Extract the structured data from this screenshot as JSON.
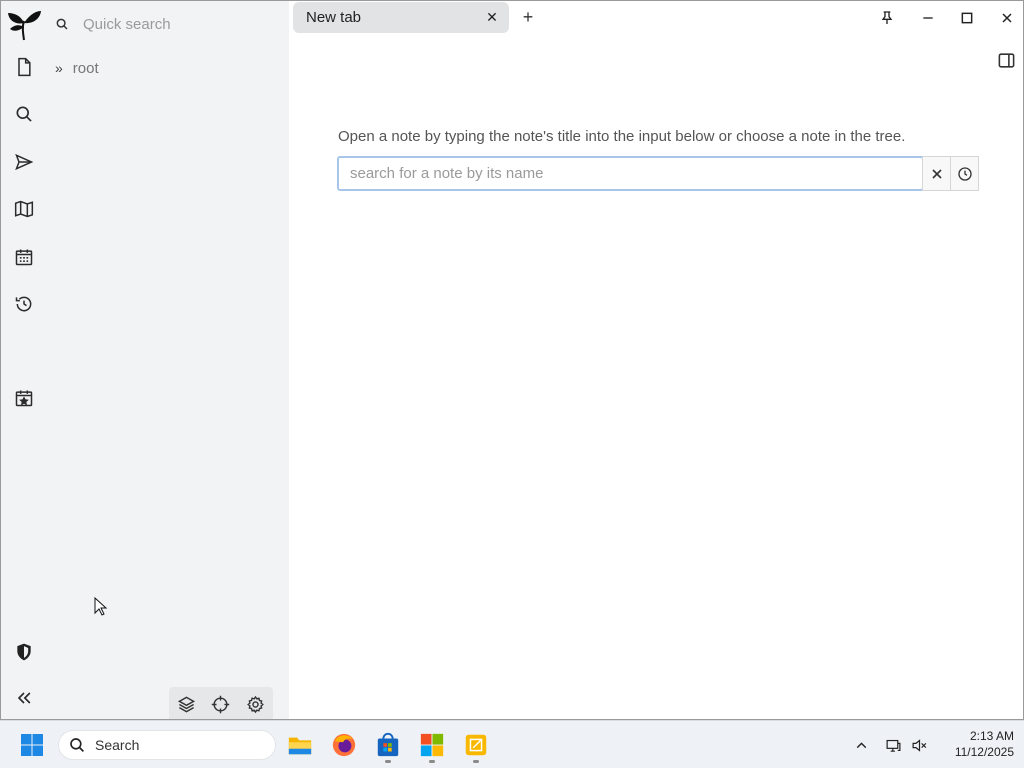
{
  "app": {
    "quick_search_placeholder": "Quick search",
    "tree": {
      "root_label": "root"
    },
    "tabs": [
      {
        "title": "New tab"
      }
    ],
    "main": {
      "help_text": "Open a note by typing the note's title into the input below or choose a note in the tree.",
      "search_placeholder": "search for a note by its name"
    },
    "accent_color": "#a8c5ea",
    "launcher_icons": [
      "new-note-icon",
      "search-icon",
      "send-icon",
      "map-icon",
      "calendar-icon",
      "history-icon",
      "calendar-star-icon",
      "shield-icon",
      "collapse-sidebar-icon"
    ],
    "bottom_tool_icons": [
      "layers-icon",
      "crosshair-icon",
      "gear-icon"
    ]
  },
  "taskbar": {
    "search_label": "Search",
    "apps": [
      "file-explorer-icon",
      "firefox-icon",
      "store-icon",
      "microsoft-icon",
      "notes-app-icon"
    ],
    "clock": {
      "time": "2:13 AM",
      "date": "11/12/2025"
    }
  }
}
